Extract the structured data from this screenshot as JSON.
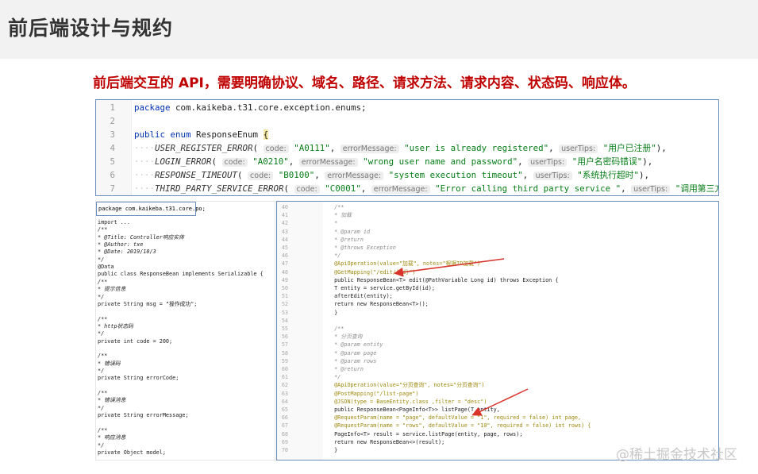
{
  "title": "前后端设计与规约",
  "subtitle": "前后端交互的 API，需要明确协议、域名、路径、请求方法、请求内容、状态码、响应体。",
  "top_code": {
    "line_numbers": [
      "1",
      "2",
      "3",
      "4",
      "5",
      "6",
      "7"
    ],
    "package_kw": "package",
    "package_name": "com.kaikeba.t31.core.exception.enums;",
    "enum_decl_kw": "public enum",
    "enum_name": "ResponseEnum",
    "brace": "{",
    "param_labels": {
      "code": "code:",
      "errorMessage": "errorMessage:",
      "userTips": "userTips:"
    },
    "entries": [
      {
        "name": "USER_REGISTER_ERROR",
        "code": "\"A0111\"",
        "message": "\"user is already registered\"",
        "tips": "\"用户已注册\""
      },
      {
        "name": "LOGIN_ERROR",
        "code": "\"A0210\"",
        "message": "\"wrong user name and password\"",
        "tips": "\"用户名密码错误\""
      },
      {
        "name": "RESPONSE_TIMEOUT",
        "code": "\"B0100\"",
        "message": "\"system execution timeout\"",
        "tips": "\"系统执行超时\""
      },
      {
        "name": "THIRD_PARTY_SERVICE_ERROR",
        "code": "\"C0001\"",
        "message": "\"Error calling third party service \"",
        "tips": "\"调用第三方服务出错\""
      }
    ],
    "entry_endings": [
      "),",
      "),",
      "),",
      ")"
    ]
  },
  "left_code": {
    "package_line": "package com.kaikeba.t31.core.po;",
    "lines": [
      "import ...",
      "/**",
      " * @Title: Controller响应实体",
      " * @Author: txe",
      " * @Date:  2019/10/3",
      " */",
      "@Data",
      "public class ResponseBean implements Serializable {",
      "    /**",
      "     * 提示信息",
      "     */",
      "    private String msg = \"操作成功\";",
      "",
      "    /**",
      "     * http状态码",
      "     */",
      "    private int code = 200;",
      "",
      "    /**",
      "     * 错误码",
      "     */",
      "    private String errorCode;",
      "",
      "    /**",
      "     * 错误消息",
      "     */",
      "    private String errorMessage;",
      "",
      "    /**",
      "     * 响应消息",
      "     */",
      "    private Object model;"
    ]
  },
  "right_code": {
    "lines": [
      {
        "n": "40",
        "t": "    /**"
      },
      {
        "n": "41",
        "t": "     * 加载"
      },
      {
        "n": "42",
        "t": "     *"
      },
      {
        "n": "43",
        "t": "     * @param id"
      },
      {
        "n": "44",
        "t": "     * @return"
      },
      {
        "n": "45",
        "t": "     * @throws Exception"
      },
      {
        "n": "46",
        "t": "     */"
      },
      {
        "n": "47",
        "t": "    @ApiOperation(value=\"加载\", notes=\"根据ID加载\")"
      },
      {
        "n": "48",
        "t": "    @GetMapping(\"/edit/{id}\")"
      },
      {
        "n": "49",
        "t": "    public ResponseBean<T> edit(@PathVariable Long id) throws Exception {"
      },
      {
        "n": "50",
        "t": "        T entity = service.getById(id);"
      },
      {
        "n": "51",
        "t": "        afterEdit(entity);"
      },
      {
        "n": "52",
        "t": "        return new ResponseBean<T>();"
      },
      {
        "n": "53",
        "t": "    }"
      },
      {
        "n": "54",
        "t": ""
      },
      {
        "n": "55",
        "t": "    /**"
      },
      {
        "n": "56",
        "t": "     * 分页查询"
      },
      {
        "n": "57",
        "t": "     * @param entity"
      },
      {
        "n": "58",
        "t": "     * @param page"
      },
      {
        "n": "59",
        "t": "     * @param rows"
      },
      {
        "n": "60",
        "t": "     * @return"
      },
      {
        "n": "61",
        "t": "     */"
      },
      {
        "n": "62",
        "t": "    @ApiOperation(value=\"分页查询\", notes=\"分页查询\")"
      },
      {
        "n": "63",
        "t": "    @PostMapping(\"/list-page\")"
      },
      {
        "n": "64",
        "t": "    @JSON(type = BaseEntity.class ,filter = \"desc\")"
      },
      {
        "n": "65",
        "t": "    public ResponseBean<PageInfo<T>> listPage(T entity,"
      },
      {
        "n": "66",
        "t": "                @RequestParam(name = \"page\", defaultValue = \"1\", required = false) int page,"
      },
      {
        "n": "67",
        "t": "                @RequestParam(name = \"rows\", defaultValue = \"10\", required = false) int rows) {"
      },
      {
        "n": "68",
        "t": "        PageInfo<T> result = service.listPage(entity, page, rows);"
      },
      {
        "n": "69",
        "t": "        return new ResponseBean<>(result);"
      },
      {
        "n": "70",
        "t": "    }"
      }
    ]
  },
  "watermark": "@稀土掘金技术社区",
  "colors": {
    "title": "#333333",
    "subtitle": "#c00000",
    "panel_border": "#6c8ebf",
    "arrow": "#d9332b"
  }
}
